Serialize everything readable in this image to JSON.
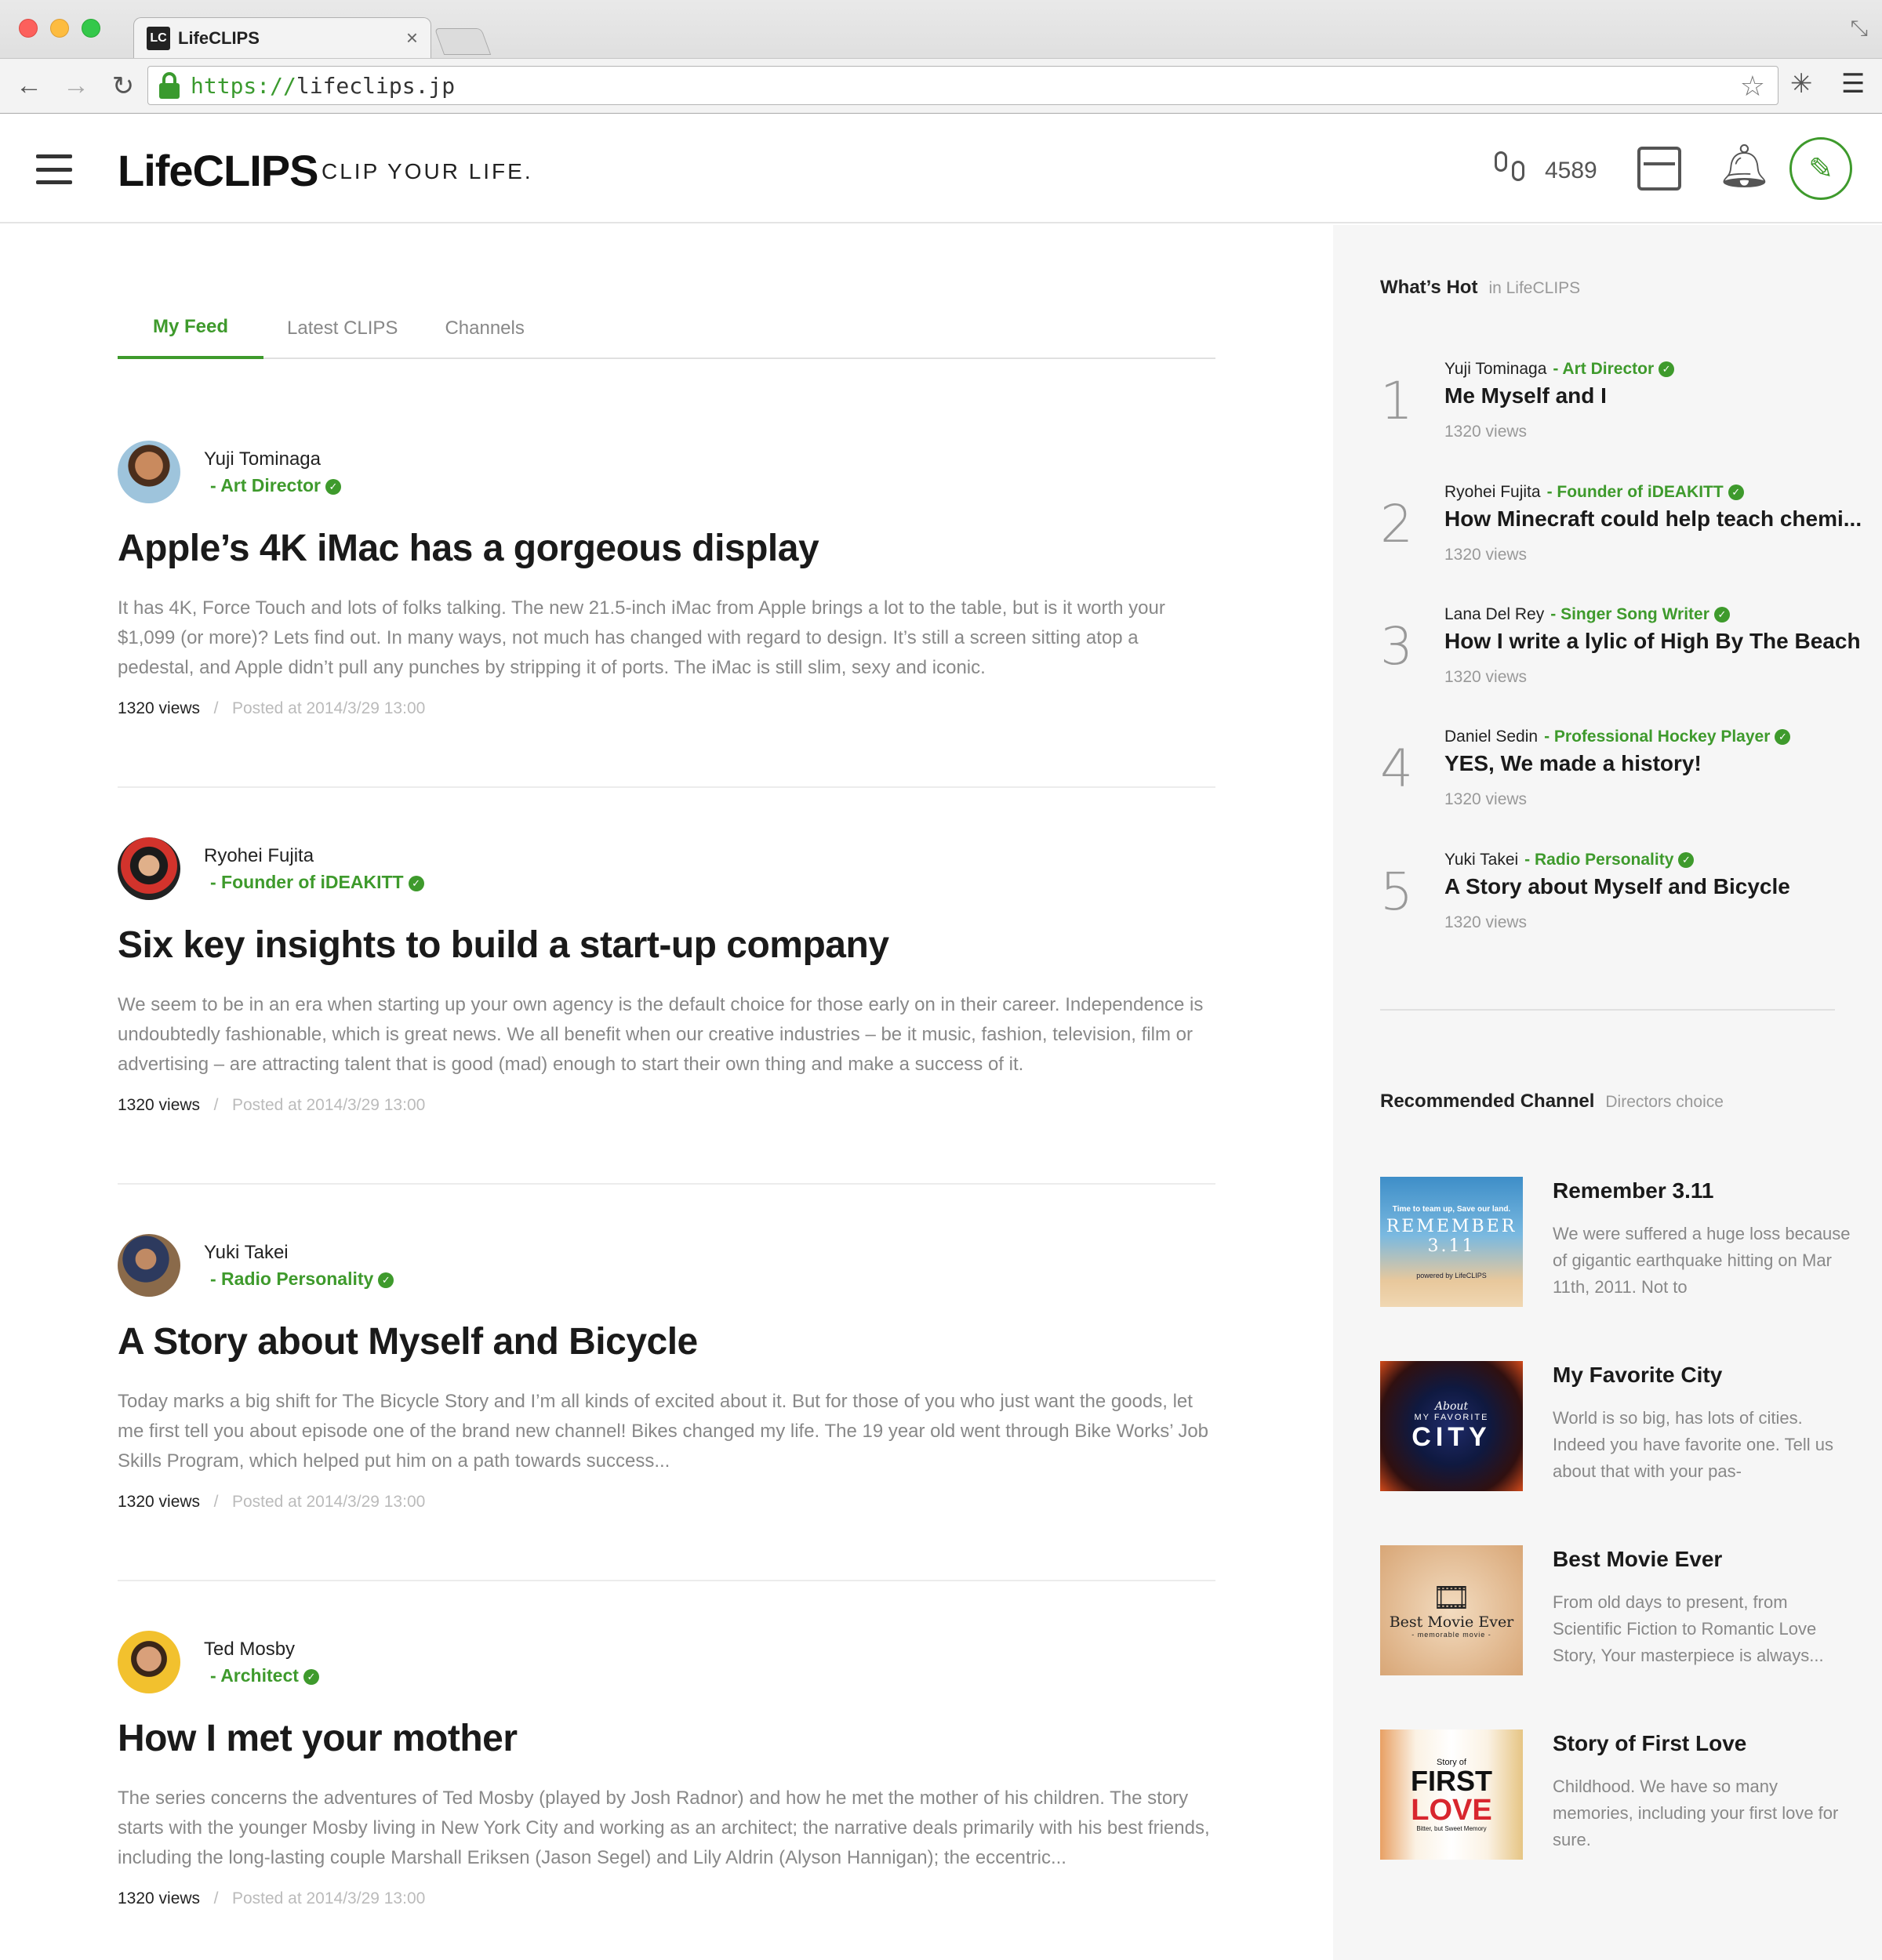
{
  "browser": {
    "tab_title": "LifeCLIPS",
    "tab_favicon": "LC",
    "url_scheme": "https://",
    "url_host": "lifeclips.jp",
    "icons": [
      "back-icon",
      "forward-icon",
      "reload-icon",
      "lock-icon",
      "star-icon",
      "extension-icon",
      "menu-icon"
    ]
  },
  "header": {
    "logo": "LifeCLIPS",
    "tagline": "CLIP YOUR LIFE.",
    "steps_count": "4589"
  },
  "colors": {
    "accent": "#3e9a2c",
    "sidebar_bg": "#f6f6f6",
    "muted_text": "#888888"
  },
  "feed_tabs": [
    {
      "label": "My Feed",
      "active": true
    },
    {
      "label": "Latest CLIPS",
      "active": false
    },
    {
      "label": "Channels",
      "active": false
    }
  ],
  "posts": [
    {
      "author": "Yuji Tominaga",
      "role": "- Art Director",
      "title": "Apple’s 4K iMac has a gorgeous display",
      "body": "It has 4K, Force Touch and lots of folks talking. The new 21.5-inch iMac from Apple brings a lot to the table, but is it worth your $1,099 (or more)? Lets find out. In many ways, not much has changed with regard to design. It’s still a screen sitting atop a pedestal, and Apple didn’t pull any punches by stripping it of ports. The iMac is still slim, sexy and iconic.",
      "views": "1320 views",
      "posted": "Posted at 2014/3/29 13:00"
    },
    {
      "author": "Ryohei Fujita",
      "role": "- Founder of iDEAKITT",
      "title": "Six key insights to build a start-up company",
      "body": "We seem to be in an era when starting up your own agency is the default choice for those early on in their career. Independence is undoubtedly fashionable, which is great news. We all benefit when our creative industries – be it music, fashion, television, film or advertising – are attracting talent that is good (mad) enough to start their own thing and make a success of it.",
      "views": "1320 views",
      "posted": "Posted at 2014/3/29 13:00"
    },
    {
      "author": "Yuki Takei",
      "role": "- Radio Personality",
      "title": "A Story about Myself and Bicycle",
      "body": "Today marks a big shift for The Bicycle Story and I’m all kinds of excited about it. But for those of you who just want the goods, let me first tell you about episode one of the brand new channel! Bikes changed my life. The 19 year old went through Bike Works’ Job Skills Program, which helped put him on a path towards success...",
      "views": "1320 views",
      "posted": "Posted at 2014/3/29 13:00"
    },
    {
      "author": "Ted Mosby",
      "role": "- Architect",
      "title": "How I met your mother",
      "body": "The series concerns the adventures of Ted Mosby (played by Josh Radnor) and how he met the mother of his children. The story starts with the younger Mosby living in New York City and working as an architect; the narrative deals primarily with his best friends, including the long-lasting couple Marshall Eriksen (Jason Segel) and Lily Aldrin (Alyson Hannigan); the eccentric...",
      "views": "1320 views",
      "posted": "Posted at 2014/3/29 13:00"
    }
  ],
  "meta_separator": "/",
  "whats_hot": {
    "title": "What’s Hot",
    "subtitle": "in LifeCLIPS",
    "items": [
      {
        "rank": "1",
        "author": "Yuji Tominaga",
        "role": "- Art Director",
        "title": "Me Myself and I",
        "views": "1320 views"
      },
      {
        "rank": "2",
        "author": "Ryohei Fujita",
        "role": "- Founder of iDEAKITT",
        "title": "How Minecraft could help teach chemi...",
        "views": "1320 views"
      },
      {
        "rank": "3",
        "author": "Lana Del Rey",
        "role": "- Singer Song Writer",
        "title": "How I write a lylic of High By The Beach",
        "views": "1320 views"
      },
      {
        "rank": "4",
        "author": "Daniel Sedin",
        "role": "- Professional Hockey Player",
        "title": "YES, We made a history!",
        "views": "1320 views"
      },
      {
        "rank": "5",
        "author": "Yuki Takei",
        "role": "- Radio Personality",
        "title": "A Story about Myself and Bicycle",
        "views": "1320 views"
      }
    ]
  },
  "recommended": {
    "title": "Recommended Channel",
    "subtitle": "Directors choice",
    "channels": [
      {
        "title": "Remember 3.11",
        "desc": "We were suffered a huge loss because of gigantic earthquake hitting on Mar 11th, 2011. Not to",
        "thumb": {
          "line1": "Time to team up, Save our land.",
          "line2": "REMEMBER 3.11",
          "line3": "powered by LifeCLIPS"
        }
      },
      {
        "title": "My Favorite City",
        "desc": "World is so big, has lots of cities. Indeed you have favorite one. Tell us about that with your pas-",
        "thumb": {
          "line1": "About",
          "line2": "MY FAVORITE",
          "line3": "CITY"
        }
      },
      {
        "title": "Best Movie Ever",
        "desc": "From old days to present, from Scientific Fiction to Romantic Love Story, Your masterpiece is always...",
        "thumb": {
          "line1": "Best Movie Ever",
          "line2": "- memorable movie -"
        }
      },
      {
        "title": "Story of First Love",
        "desc": "Childhood. We have so many memories, including your first love for sure.",
        "thumb": {
          "line0": "Story of",
          "line1": "FIRST",
          "line2": "LOVE",
          "line3": "Bitter, but Sweet Memory"
        }
      }
    ]
  }
}
